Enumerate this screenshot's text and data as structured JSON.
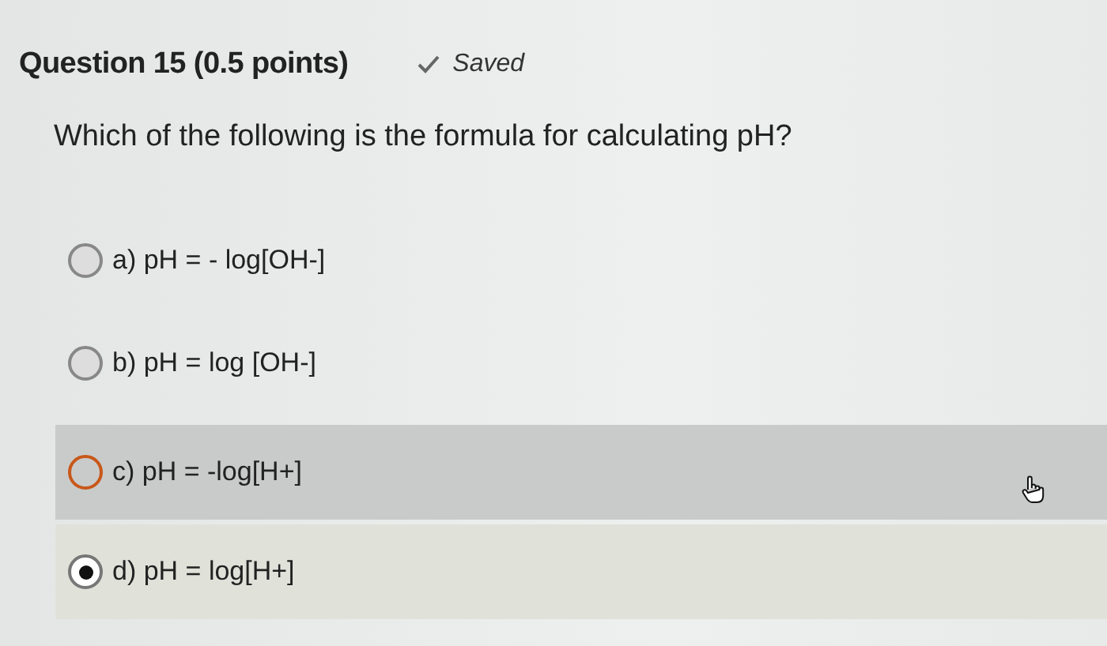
{
  "question": {
    "title": "Question 15 (0.5 points)",
    "status": "Saved",
    "saved": true,
    "prompt": "Which of the following is the formula for calculating pH?"
  },
  "options": [
    {
      "label": "a) pH = - log[OH-]",
      "selected": false,
      "hovered": false
    },
    {
      "label": "b) pH = log [OH-]",
      "selected": false,
      "hovered": false
    },
    {
      "label": "c) pH = -log[H+]",
      "selected": false,
      "hovered": true
    },
    {
      "label": "d) pH = log[H+]",
      "selected": true,
      "hovered": false
    }
  ]
}
